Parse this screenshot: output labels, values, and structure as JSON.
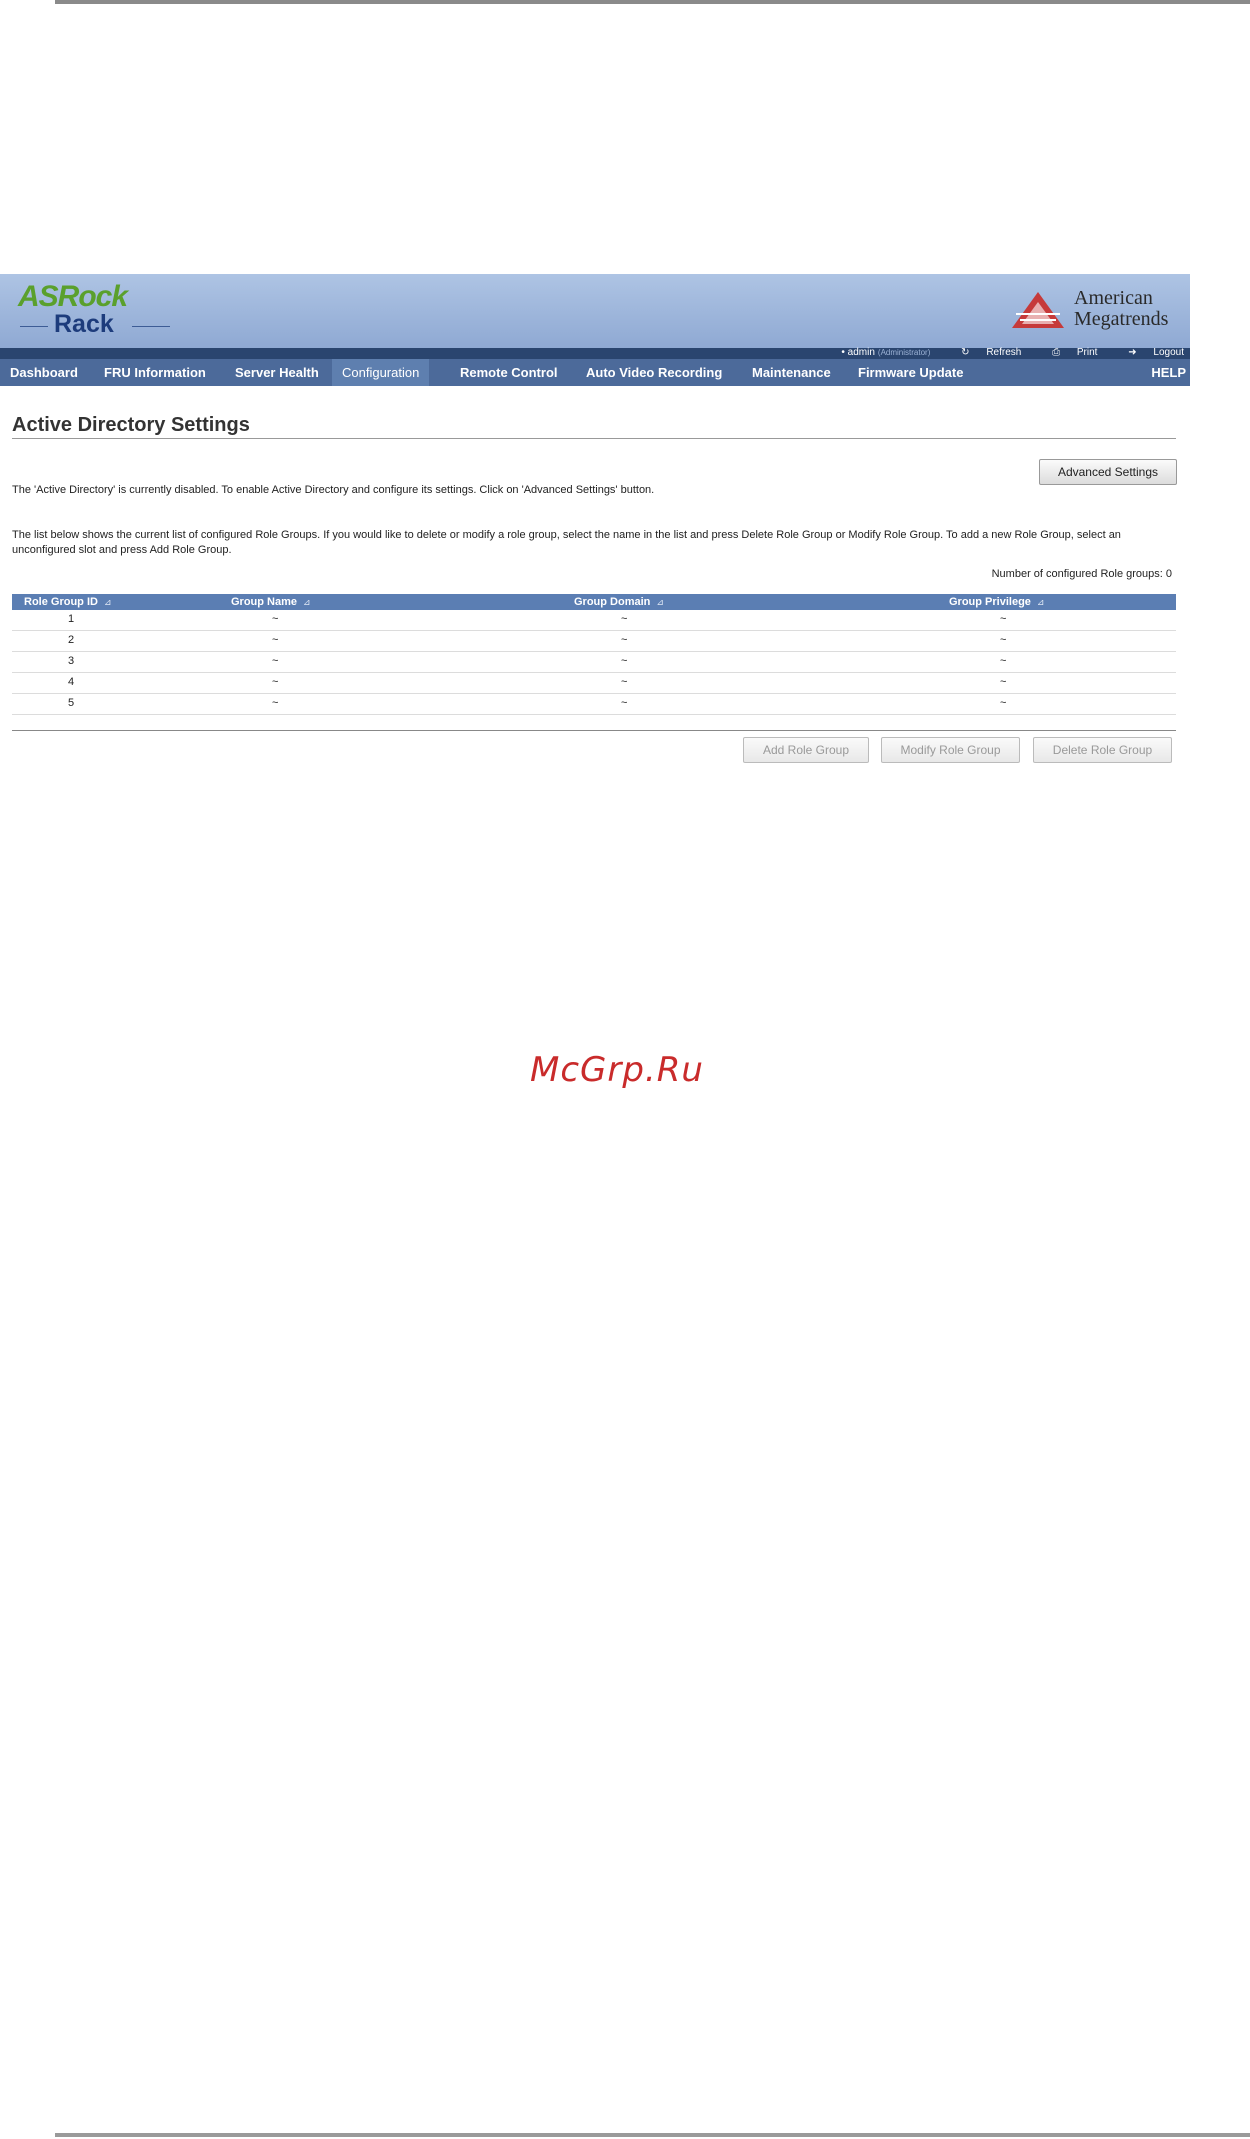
{
  "header": {
    "brand_top": "ASRock",
    "brand_bottom": "Rack",
    "vendor_line1": "American",
    "vendor_line2": "Megatrends"
  },
  "userbar": {
    "user": "• admin",
    "role": "(Administrator)",
    "refresh": "Refresh",
    "print": "Print",
    "logout": "Logout"
  },
  "nav": {
    "tabs": [
      {
        "label": "Dashboard"
      },
      {
        "label": "FRU Information"
      },
      {
        "label": "Server Health"
      },
      {
        "label": "Configuration",
        "active": true
      },
      {
        "label": "Remote Control"
      },
      {
        "label": "Auto Video Recording"
      },
      {
        "label": "Maintenance"
      },
      {
        "label": "Firmware Update"
      }
    ],
    "help": "HELP"
  },
  "page": {
    "title": "Active Directory Settings",
    "advanced_button": "Advanced Settings",
    "status_text": "The 'Active Directory' is currently disabled. To enable Active Directory and configure its settings. Click on 'Advanced Settings' button.",
    "description": "The list below shows the current list of configured Role Groups. If you would like to delete or modify a role group, select the name in the list and press Delete Role Group or Modify Role Group. To add a new Role Group, select an unconfigured slot and press Add Role Group.",
    "count_text": "Number of configured Role groups: 0"
  },
  "table": {
    "columns": [
      "Role Group ID",
      "Group Name",
      "Group Domain",
      "Group Privilege"
    ],
    "sort_glyph": "⊿",
    "rows": [
      [
        "1",
        "~",
        "~",
        "~"
      ],
      [
        "2",
        "~",
        "~",
        "~"
      ],
      [
        "3",
        "~",
        "~",
        "~"
      ],
      [
        "4",
        "~",
        "~",
        "~"
      ],
      [
        "5",
        "~",
        "~",
        "~"
      ]
    ]
  },
  "actions": {
    "add": "Add Role Group",
    "modify": "Modify Role Group",
    "delete": "Delete Role Group"
  },
  "watermark": "McGrp.Ru",
  "colors": {
    "nav_bg": "#4c6a9a",
    "table_header_bg": "#5b7eb3",
    "brand_green": "#5aa02c",
    "watermark_red": "#c92b2b"
  }
}
